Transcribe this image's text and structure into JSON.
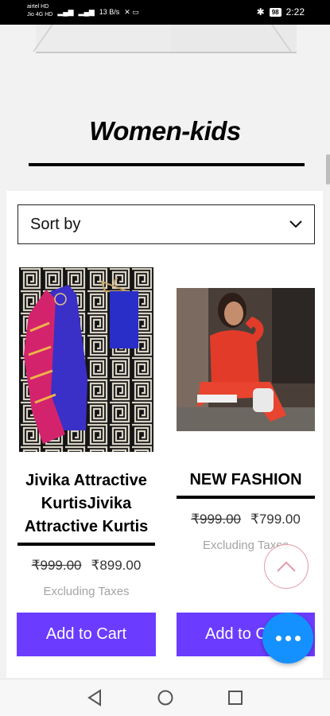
{
  "status_bar": {
    "carrier1": "airtel",
    "carrier1_badge": "HD",
    "carrier2": "Jio 4G",
    "carrier2_badge": "HD",
    "net_speed": "13 B/s",
    "battery": "98",
    "time": "2:22"
  },
  "page": {
    "title": "Women-kids"
  },
  "sort": {
    "label": "Sort by"
  },
  "products": [
    {
      "name": "Jivika Attractive KurtisJivika Attractive Kurtis",
      "old_price": "₹999.00",
      "price": "₹899.00",
      "tax_note": "Excluding Taxes",
      "button": "Add to Cart"
    },
    {
      "name": "NEW FASHION",
      "old_price": "₹999.00",
      "price": "₹799.00",
      "tax_note": "Excluding Taxes",
      "button": "Add to C"
    }
  ],
  "colors": {
    "accent": "#6b3cff",
    "fab": "#1591ff"
  },
  "icons": {
    "scroll_top": "chevron-up-icon",
    "fab": "more-horizontal-icon",
    "nav_back": "back-triangle-icon",
    "nav_home": "home-circle-icon",
    "nav_recents": "recents-square-icon"
  }
}
